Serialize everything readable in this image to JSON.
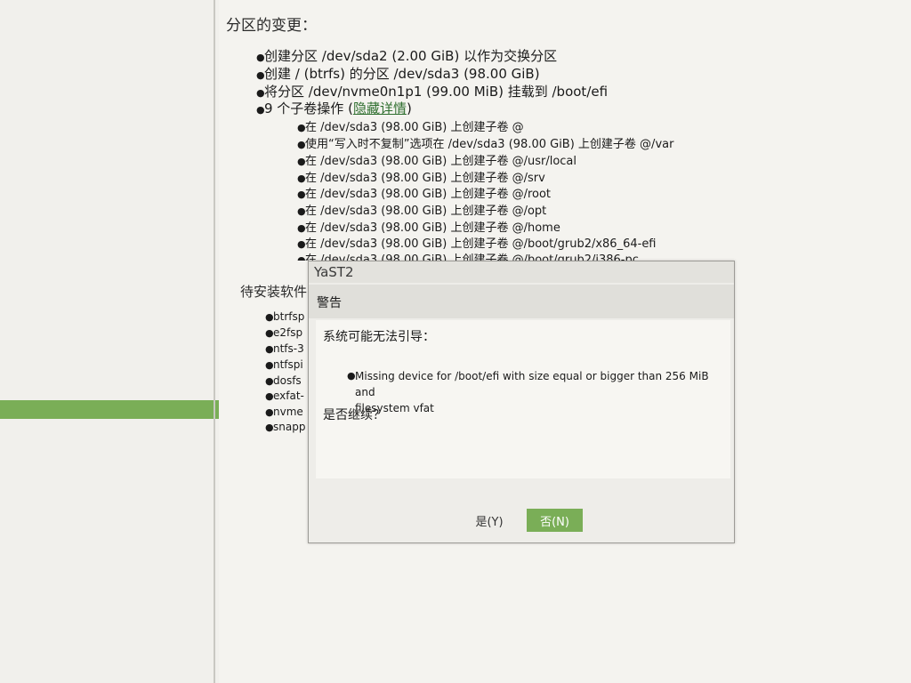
{
  "summary": {
    "partition_title": "分区的变更：",
    "partition_items": [
      "创建分区 /dev/sda2 (2.00 GiB) 以作为交换分区",
      "创建 / (btrfs) 的分区 /dev/sda3 (98.00 GiB)",
      "将分区 /dev/nvme0n1p1 (99.00 MiB) 挂载到 /boot/efi"
    ],
    "subvol_intro": "9 个子卷操作 (",
    "subvol_link": "隐藏详情",
    "subvol_close": ")",
    "subvol_items": [
      "在 /dev/sda3 (98.00 GiB) 上创建子卷 @",
      "使用“写入时不复制”选项在 /dev/sda3 (98.00 GiB) 上创建子卷 @/var",
      "在 /dev/sda3 (98.00 GiB) 上创建子卷 @/usr/local",
      "在 /dev/sda3 (98.00 GiB) 上创建子卷 @/srv",
      "在 /dev/sda3 (98.00 GiB) 上创建子卷 @/root",
      "在 /dev/sda3 (98.00 GiB) 上创建子卷 @/opt",
      "在 /dev/sda3 (98.00 GiB) 上创建子卷 @/home",
      "在 /dev/sda3 (98.00 GiB) 上创建子卷 @/boot/grub2/x86_64-efi",
      "在 /dev/sda3 (98.00 GiB) 上创建子卷 @/boot/grub2/i386-pc"
    ],
    "packages_title": "待安装软件",
    "packages": [
      "btrfsp",
      "e2fsp",
      "ntfs-3",
      "ntfspi",
      "dosfs",
      "exfat-",
      "nvme",
      "snapp"
    ]
  },
  "dialog": {
    "title": "YaST2",
    "heading": "警告",
    "lead": "系统可能无法引导：",
    "message_line1": "Missing device for /boot/efi with size equal or bigger than 256 MiB and",
    "message_line2": "filesystem vfat",
    "question": "是否继续？",
    "yes_label": "是(Y)",
    "no_label": "否(N)"
  },
  "colors": {
    "accent": "#7aae57",
    "link": "#2f6f2f"
  }
}
